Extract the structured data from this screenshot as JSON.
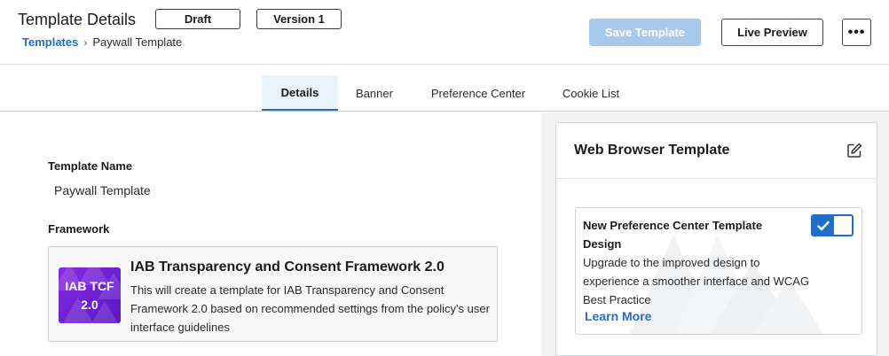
{
  "header": {
    "title": "Template Details",
    "status_pill": "Draft",
    "version_pill": "Version 1",
    "breadcrumb": {
      "link": "Templates",
      "separator": "›",
      "current": "Paywall Template"
    },
    "save_label": "Save Template",
    "preview_label": "Live Preview",
    "more_label": "•••"
  },
  "tabs": [
    {
      "label": "Details",
      "active": true
    },
    {
      "label": "Banner",
      "active": false
    },
    {
      "label": "Preference Center",
      "active": false
    },
    {
      "label": "Cookie List",
      "active": false
    }
  ],
  "details": {
    "name_label": "Template Name",
    "name_value": "Paywall Template",
    "framework_label": "Framework",
    "framework": {
      "logo_line1": "IAB TCF",
      "logo_line2": "2.0",
      "title": "IAB Transparency and Consent Framework 2.0",
      "description": "This will create a template for IAB Transparency and Consent Framework 2.0 based on recommended settings from the policy's user interface guidelines"
    }
  },
  "web_template": {
    "title": "Web Browser Template",
    "promo": {
      "title": "New Preference Center Template Design",
      "description": "Upgrade to the improved design to experience a smoother interface and WCAG Best Practice",
      "link": "Learn More",
      "toggle_on": true
    }
  },
  "colors": {
    "accent": "#1f6fc8",
    "save_disabled": "#a7c9ec",
    "active_tab_bg": "#eaf2fb",
    "iab_purple": "#7b25db"
  },
  "icons": {
    "edit": "edit-icon",
    "check": "check-icon",
    "chevron": "chevron-right-icon",
    "more": "more-horizontal-icon"
  }
}
